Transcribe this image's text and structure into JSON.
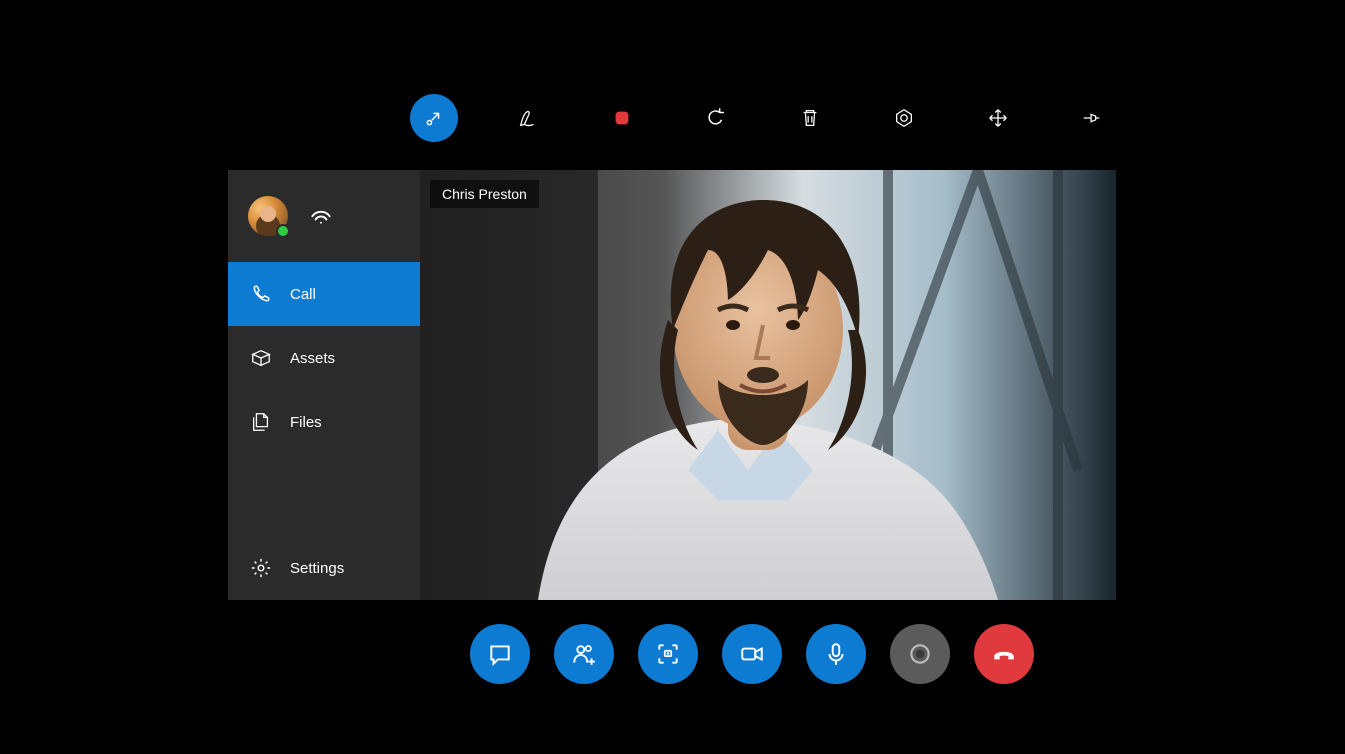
{
  "participant": {
    "name": "Chris Preston"
  },
  "sidebar": {
    "items": [
      {
        "icon": "phone-icon",
        "label": "Call",
        "active": true
      },
      {
        "icon": "box-icon",
        "label": "Assets",
        "active": false
      },
      {
        "icon": "files-icon",
        "label": "Files",
        "active": false
      }
    ],
    "settings_label": "Settings"
  },
  "top_toolbar": [
    {
      "icon": "minimize-icon",
      "active": true
    },
    {
      "icon": "pen-icon"
    },
    {
      "icon": "stop-record-icon"
    },
    {
      "icon": "undo-icon"
    },
    {
      "icon": "trash-icon"
    },
    {
      "icon": "aperture-icon"
    },
    {
      "icon": "move-icon"
    },
    {
      "icon": "pin-icon"
    }
  ],
  "call_bar": [
    {
      "icon": "chat-icon",
      "style": "blue"
    },
    {
      "icon": "add-person-icon",
      "style": "blue"
    },
    {
      "icon": "snapshot-icon",
      "style": "blue"
    },
    {
      "icon": "video-icon",
      "style": "blue"
    },
    {
      "icon": "mic-icon",
      "style": "blue"
    },
    {
      "icon": "record-icon",
      "style": "grey"
    },
    {
      "icon": "hangup-icon",
      "style": "red"
    }
  ],
  "colors": {
    "accent": "#0e7bd2",
    "danger": "#e0393e",
    "neutral": "#5b5b5b"
  }
}
